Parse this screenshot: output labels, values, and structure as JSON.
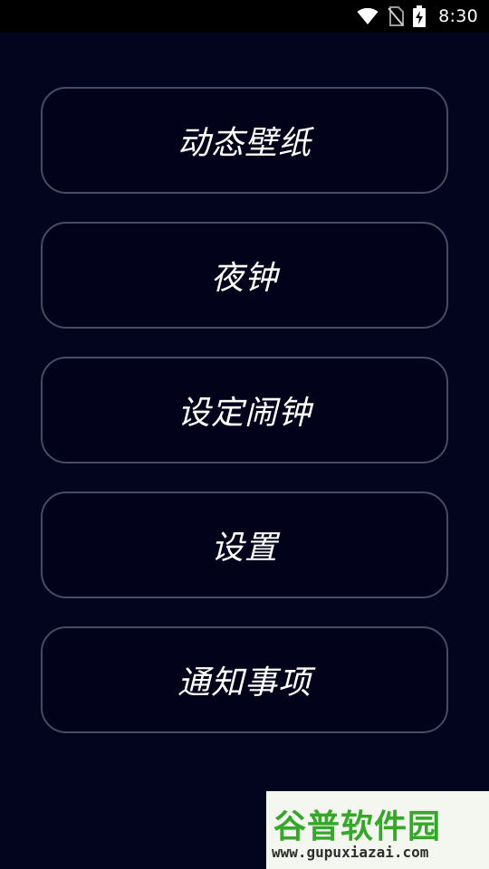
{
  "status_bar": {
    "time": "8:30",
    "icons": [
      "wifi-icon",
      "no-sim-icon",
      "battery-charging-icon"
    ]
  },
  "menu": {
    "items": [
      {
        "label": "动态壁纸"
      },
      {
        "label": "夜钟"
      },
      {
        "label": "设定闹钟"
      },
      {
        "label": "设置"
      },
      {
        "label": "通知事项"
      }
    ]
  },
  "watermark": {
    "title": "谷普软件园",
    "url": "www.gupuxiazai.com"
  },
  "colors": {
    "background": "#03041e",
    "button_border": "#4a4a66",
    "button_fill": "#02021a",
    "text": "#ffffff"
  }
}
